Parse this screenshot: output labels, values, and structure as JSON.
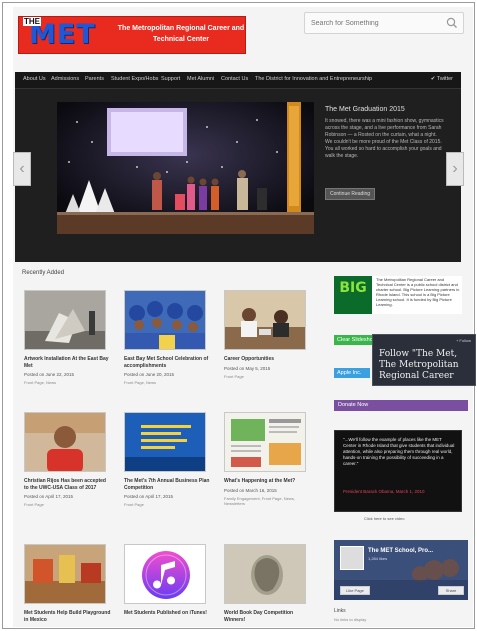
{
  "header": {
    "logo_the": "THE",
    "logo_met": "MET",
    "logo_tagline": "The Metropolitan Regional Career and Technical Center",
    "search_placeholder": "Search for Something"
  },
  "nav": {
    "items": [
      "About Us",
      "Admissions",
      "Parents",
      "Student Expo/Hobs",
      "Support",
      "Met Alumni",
      "Contact Us",
      "The District for Innovation and Entrepreneurship"
    ],
    "twitter": "Twitter"
  },
  "slider": {
    "title": "The Met Graduation 2015",
    "body": "It snowed, there was a mini fashion show, gymnastics across the stage, and a live performance from Sarah Robinson — a Rosted on the curtain, what a night. We couldn't be more proud of the Met Class of 2015. You all worked so hard to accomplish your goals and walk the stage.",
    "continue_label": "Continue Reading",
    "prev": "‹",
    "next": "›"
  },
  "recent": {
    "heading": "Recently Added",
    "cards": [
      {
        "title": "Artwork Installation At the East Bay Met",
        "date": "Posted on June 22, 2015",
        "tags": "Front Page, News"
      },
      {
        "title": "East Bay Met School Celebration of accomplishments",
        "date": "Posted on June 20, 2015",
        "tags": "Front Page, News"
      },
      {
        "title": "Career Opportunities",
        "date": "Posted on May 5, 2015",
        "tags": "Front Page"
      },
      {
        "title": "Christian Rijos Has been accepted to the UWC-USA Class of 2017",
        "date": "Posted on April 17, 2015",
        "tags": "Front Page"
      },
      {
        "title": "The Met's 7th Annual Business Plan Competition",
        "date": "Posted on April 17, 2015",
        "tags": "Front Page"
      },
      {
        "title": "What's Happening at the Met?",
        "date": "Posted on March 16, 2015",
        "tags": "Family Engagement, Front Page, News, Newsletters"
      },
      {
        "title": "Met Students Help Build Playground in Mexico",
        "date": "",
        "tags": ""
      },
      {
        "title": "Met Students Published on iTunes!",
        "date": "",
        "tags": ""
      },
      {
        "title": "World Book Day Competition Winners!",
        "date": "",
        "tags": ""
      }
    ]
  },
  "sidebar": {
    "big_logo": "BIG",
    "big_text": "The Metropolitan Regional Career and Technical Center is a public school district and charter school. Big Picture Learning partners in Rhode Island. This school is a Big Picture Learning school. It is funded by Big Picture Learning.",
    "green_label": "Clear Slideshow",
    "blue_label": "Apple Inc.",
    "follow_button": "+ Follow",
    "follow_text": "Follow \"The Met, The Metropolitan Regional Career",
    "donate_label": "Donate Now",
    "quote": "\"...We'll follow the example of places like the MET Center in Rhode Island that give students that individual attention, while also preparing them through real world, hands-on training the possibility of succeeding in a career.\"",
    "quote_author": "President Barack Obama, March 1, 2010",
    "quote_link": "Click here to see video",
    "fb_title": "The MET School, Pro...",
    "fb_likes": "1,284 likes",
    "fb_like": "Like Page",
    "fb_share": "Share",
    "links_heading": "Links",
    "links_sub": "No links to display"
  },
  "colors": {
    "logo_red": "#e82a1f",
    "logo_blue": "#1e58d6",
    "green": "#39b54a",
    "blue": "#3aa0e0",
    "purple": "#7b4fa0",
    "dark": "#1f1f1f"
  }
}
